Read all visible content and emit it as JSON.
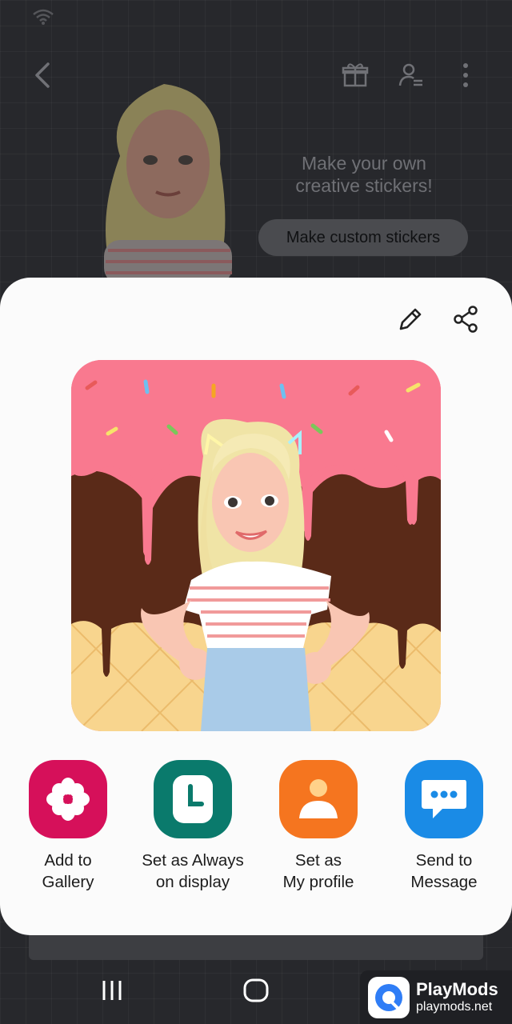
{
  "background_app": {
    "promo_text": "Make your own\ncreative stickers!",
    "promo_button": "Make custom stickers",
    "icons": [
      "back-icon",
      "gift-icon",
      "profile-settings-icon",
      "more-icon"
    ]
  },
  "sheet": {
    "icons": [
      "edit-icon",
      "share-icon"
    ],
    "actions": [
      {
        "label": "Add to\nGallery",
        "icon": "gallery-flower-icon",
        "color": "#d6105a"
      },
      {
        "label": "Set as Always\non display",
        "icon": "clock-icon",
        "color": "#0a7a6c"
      },
      {
        "label": "Set as\nMy profile",
        "icon": "person-icon",
        "color": "#f5751f"
      },
      {
        "label": "Send to\nMessage",
        "icon": "message-icon",
        "color": "#1a8be6"
      }
    ]
  },
  "watermark": {
    "name": "PlayMods",
    "url": "playmods.net"
  },
  "colors": {
    "sheet_bg": "#fbfbfb",
    "sticker_pink": "#f9798f",
    "sticker_chocolate": "#5a2a18",
    "sticker_waffle": "#f8d58e"
  }
}
